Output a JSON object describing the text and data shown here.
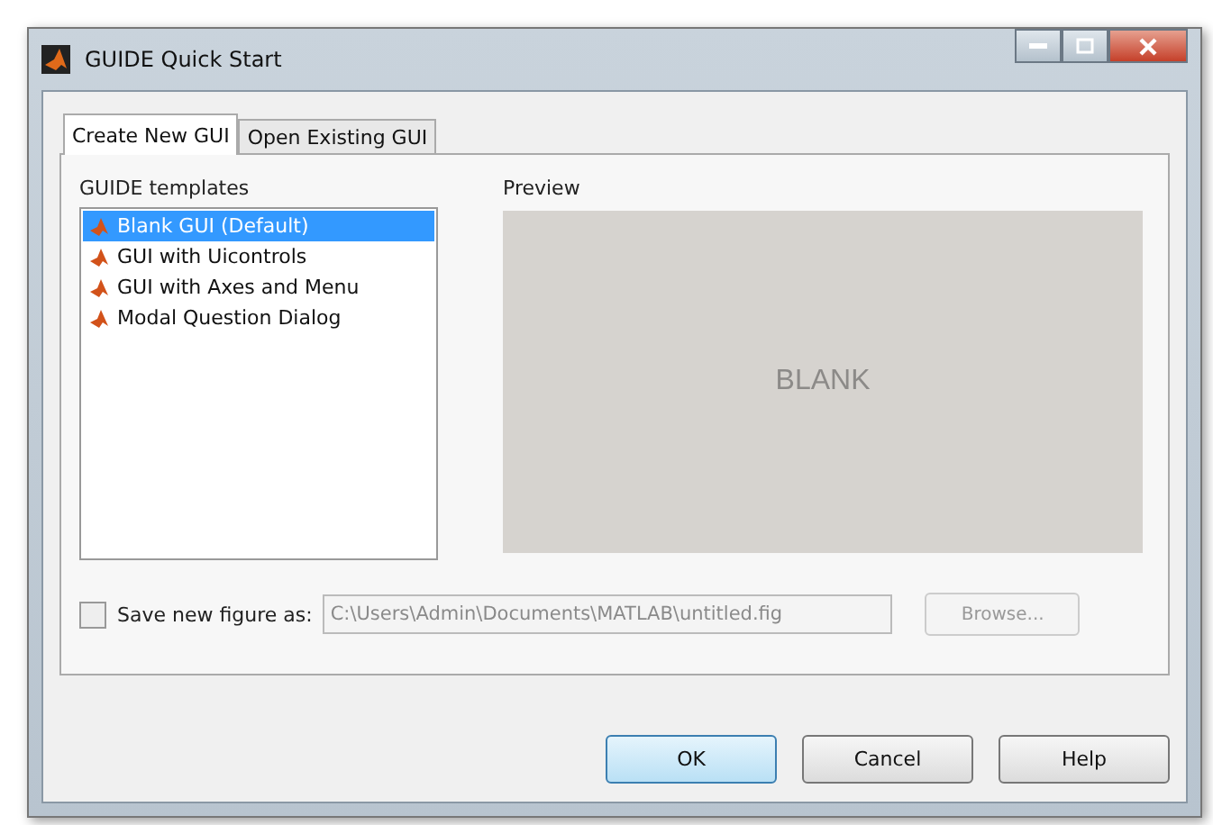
{
  "window": {
    "title": "GUIDE Quick Start"
  },
  "tabs": [
    {
      "label": "Create New GUI",
      "selected": true
    },
    {
      "label": "Open Existing GUI",
      "selected": false
    }
  ],
  "templates": {
    "label": "GUIDE templates",
    "items": [
      {
        "label": "Blank GUI (Default)",
        "selected": true
      },
      {
        "label": "GUI with Uicontrols",
        "selected": false
      },
      {
        "label": "GUI with Axes and Menu",
        "selected": false
      },
      {
        "label": "Modal Question Dialog",
        "selected": false
      }
    ]
  },
  "preview": {
    "label": "Preview",
    "text": "BLANK"
  },
  "save": {
    "label": "Save new figure as:",
    "checked": false,
    "path": "C:\\Users\\Admin\\Documents\\MATLAB\\untitled.fig",
    "disabled": true,
    "browse": "Browse..."
  },
  "buttons": [
    {
      "label": "OK",
      "default": true
    },
    {
      "label": "Cancel",
      "default": false
    },
    {
      "label": "Help",
      "default": false
    }
  ]
}
